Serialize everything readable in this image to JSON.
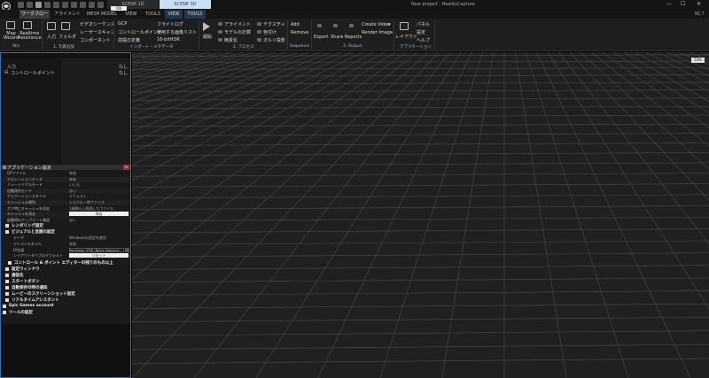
{
  "titlebar": {
    "scene_1d": "SCENE 1D",
    "scene_3d": "SCENE 3D",
    "project_title": "New project - RealityCapture",
    "window_buttons": [
      "—",
      "☐",
      "✕"
    ]
  },
  "menu": {
    "tabs": [
      {
        "label": "ワークフロー",
        "active": true
      },
      {
        "label": "アライメント"
      },
      {
        "label": "MESH MODEL"
      },
      {
        "label": "VIEW"
      },
      {
        "label": "TOOLS"
      },
      {
        "label": "VIEW",
        "context": true
      },
      {
        "label": "TOOLS",
        "context": true
      }
    ],
    "help_icons": [
      "RC",
      "?"
    ]
  },
  "ribbon": {
    "groups": [
      {
        "label": "Wiz"
      },
      {
        "label": "1. 写真追加"
      },
      {
        "label": "インポート・メタデータ"
      },
      {
        "label": "2. プロセス"
      },
      {
        "label": "Sequence"
      },
      {
        "label": "3. Output"
      },
      {
        "label": "アプリケーション"
      }
    ],
    "map_wizard": "Map\nWizard",
    "realtime_assistance": "Realtime\nAssistance",
    "input": "入力",
    "folder": "フォルダ",
    "video_sequence": "ビデオシーケンス",
    "laser_scan": "レーザースキャン",
    "component": "コンポーネント",
    "gcp": "GCP",
    "control_points": "コントロールポイント",
    "prior_definition": "前提の定義",
    "flight_log": "フライトログ",
    "used_image_list": "使用する画像リスト",
    "hdr": "16-bitHDR",
    "start": "開始",
    "align": "アライメント",
    "compute_model": "モデルの計算",
    "simplify": "簡素化",
    "texture": "テクスチャ",
    "colorize": "色付け",
    "ortho_projection": "オルソ投影",
    "add": "Add",
    "remove": "Remove",
    "export": "Export",
    "share": "Share",
    "reports": "Reports",
    "create_video": "Create Video",
    "render_image": "Render Image",
    "layout": "レイアウト",
    "panel": "パネル",
    "settings": "設定",
    "help": "ヘルプ"
  },
  "left_panel": {
    "badge": "ON",
    "tree": [
      {
        "label": "入力",
        "value": "なし"
      },
      {
        "label": "コントロールポイント",
        "value": "なし"
      }
    ]
  },
  "settings": {
    "title": "アプリケーション設定",
    "close": "✕",
    "rows": [
      {
        "key": "GPファイル",
        "value": "有効"
      },
      {
        "key": "デモレーションデータ",
        "value": "有効"
      },
      {
        "key": "ミュートリアルモード",
        "value": "いいえ"
      },
      {
        "key": "自動保存モード",
        "value": "はい"
      },
      {
        "key": "ナビゲーションスタイル",
        "value": "デフォルト"
      },
      {
        "key": "キャッシュの場所",
        "value": "システム一時ファイル"
      },
      {
        "key": "ボア時にキャッシュを消去",
        "value": "1週間以上経過したファイル"
      },
      {
        "key": "キャッシュを消去",
        "button": "消去"
      },
      {
        "key": "起動時のアップデート確認",
        "value": "はい"
      }
    ],
    "sections_top": [
      {
        "label": "レンダリング設定",
        "indent": 1
      },
      {
        "label": "ビジュアルと言語の設定",
        "indent": 1
      }
    ],
    "language_rows": [
      {
        "key": "テーマ",
        "value": "Windowsの設定を使用"
      },
      {
        "key": "アイコンスタイル",
        "value": "有効"
      },
      {
        "key": "UI言語",
        "field": "Japanese (日本 (Nihon Nipponi))"
      },
      {
        "key": "レイアウトタイプのデフォルト",
        "button": "リセット"
      }
    ],
    "sections_bottom": [
      {
        "label": "コントロール & ポイント エディターの残りのもの以上",
        "indent": 2
      },
      {
        "label": "設定ウィンドウ",
        "indent": 1
      },
      {
        "label": "通信先",
        "indent": 1
      },
      {
        "label": "スタートボタン",
        "indent": 1
      },
      {
        "label": "自動保存の時の通知",
        "indent": 1
      },
      {
        "label": "ムービーのスクリーンショット設定",
        "indent": 1
      },
      {
        "label": "リアルタイムアシスタント",
        "indent": 1
      },
      {
        "label": "Epic Games account",
        "indent": 0
      },
      {
        "label": "ツールの設定",
        "indent": 0
      }
    ]
  },
  "viewport": {
    "zoom_badge": "70%",
    "bg_color": "#202020",
    "grid_color": "#4a4a4a"
  }
}
